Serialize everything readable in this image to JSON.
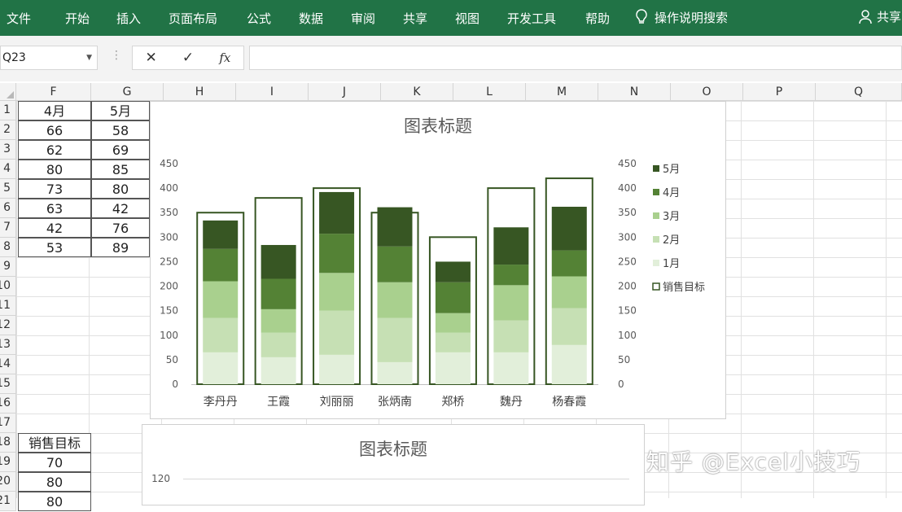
{
  "ribbon": {
    "tabs": [
      "文件",
      "开始",
      "插入",
      "页面布局",
      "公式",
      "数据",
      "审阅",
      "共享",
      "视图",
      "开发工具",
      "帮助"
    ],
    "tell_me": "操作说明搜索",
    "share": "共享",
    "bg_color": "#217346"
  },
  "formula_bar": {
    "name_box": "Q23",
    "cancel_icon": "✕",
    "enter_icon": "✓",
    "fx_label": "fx",
    "formula_value": ""
  },
  "columns": [
    "F",
    "G",
    "H",
    "I",
    "J",
    "K",
    "L",
    "M",
    "N",
    "O",
    "P",
    "Q"
  ],
  "rows": [
    "1",
    "2",
    "3",
    "4",
    "5",
    "6",
    "7",
    "8",
    "9",
    "10",
    "11",
    "12",
    "13",
    "14",
    "15",
    "16",
    "17",
    "18",
    "19",
    "20",
    "21"
  ],
  "table": {
    "headers": [
      "4月",
      "5月"
    ],
    "values": [
      [
        "66",
        "58"
      ],
      [
        "62",
        "69"
      ],
      [
        "80",
        "85"
      ],
      [
        "73",
        "80"
      ],
      [
        "63",
        "42"
      ],
      [
        "42",
        "76"
      ],
      [
        "53",
        "89"
      ]
    ]
  },
  "target_table": {
    "header": "销售目标",
    "values": [
      "70",
      "80",
      "80"
    ]
  },
  "chart_data": [
    {
      "type": "bar",
      "title": "图表标题",
      "categories": [
        "李丹丹",
        "王霞",
        "刘丽丽",
        "张炳南",
        "郑桥",
        "魏丹",
        "杨春霞"
      ],
      "ylim": [
        0,
        450
      ],
      "yticks": [
        "0",
        "50",
        "100",
        "150",
        "200",
        "250",
        "300",
        "350",
        "400",
        "450"
      ],
      "stacked": true,
      "series": [
        {
          "name": "1月",
          "color": "#e2efda",
          "values": [
            65,
            55,
            60,
            45,
            65,
            65,
            80
          ]
        },
        {
          "name": "2月",
          "color": "#c6e0b4",
          "values": [
            70,
            50,
            90,
            90,
            40,
            65,
            75
          ]
        },
        {
          "name": "3月",
          "color": "#a9d08e",
          "values": [
            75,
            48,
            77,
            73,
            40,
            72,
            65
          ]
        },
        {
          "name": "4月",
          "color": "#548235",
          "values": [
            66,
            62,
            80,
            73,
            63,
            42,
            53
          ]
        },
        {
          "name": "5月",
          "color": "#375623",
          "values": [
            58,
            69,
            85,
            80,
            42,
            76,
            89
          ]
        }
      ],
      "target": {
        "name": "销售目标",
        "color": "#375623",
        "values": [
          350,
          380,
          400,
          350,
          300,
          400,
          420
        ]
      },
      "legend_position": "right",
      "secondary_axis": true
    },
    {
      "type": "bar",
      "title": "图表标题",
      "yticks": [
        "120"
      ]
    }
  ],
  "watermark": "知乎 @Excel小技巧"
}
